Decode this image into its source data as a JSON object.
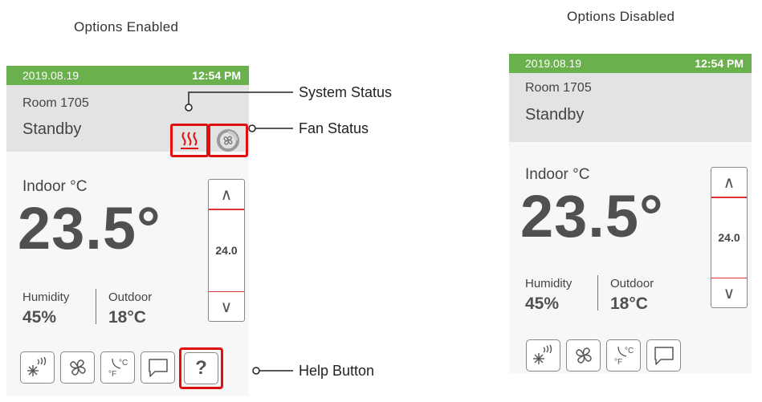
{
  "captions": {
    "left": "Options Enabled",
    "right": "Options Disabled"
  },
  "device": {
    "date": "2019.08.19",
    "time": "12:54 PM",
    "room": "Room 1705",
    "mode": "Standby",
    "indoor_label": "Indoor °C",
    "indoor_temp": "23.5°",
    "humidity_label": "Humidity",
    "humidity_value": "45%",
    "outdoor_label": "Outdoor",
    "outdoor_value": "18°C",
    "setpoint": "24.0",
    "up_symbol": "∧",
    "down_symbol": "∨",
    "help_symbol": "?",
    "icons": [
      "heat-icon",
      "fan-status-icon",
      "mode-icon",
      "fan-icon",
      "units-icon",
      "message-icon",
      "help-icon"
    ]
  },
  "callouts": {
    "system_status": "System Status",
    "fan_status": "Fan Status",
    "help_button": "Help Button"
  },
  "colors": {
    "status_bar": "#6ab04c",
    "highlight": "#e01010",
    "header": "#e3e3e3"
  }
}
